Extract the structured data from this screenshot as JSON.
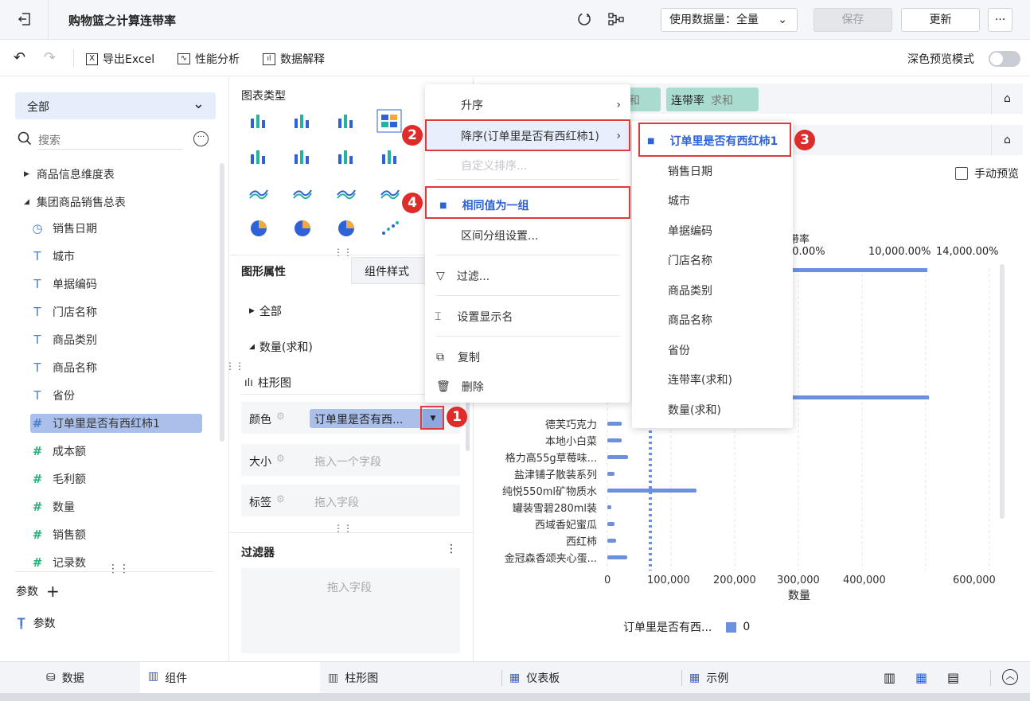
{
  "header": {
    "title": "购物篮之计算连带率",
    "data_amount": "使用数据量：全量",
    "save": "保存",
    "update": "更新",
    "more": "···"
  },
  "toolbar": {
    "export_excel": "导出Excel",
    "perf_analysis": "性能分析",
    "data_explain": "数据解释",
    "dark_preview": "深色预览模式"
  },
  "left": {
    "scope": "全部",
    "search_placeholder": "搜索",
    "tables": [
      "商品信息维度表",
      "集团商品销售总表"
    ],
    "fields": [
      {
        "icon": "clock-icon",
        "glyph": "◷",
        "label": "销售日期"
      },
      {
        "icon": "text-icon",
        "glyph": "T",
        "label": "城市"
      },
      {
        "icon": "text-icon",
        "glyph": "T",
        "label": "单据编码"
      },
      {
        "icon": "text-icon",
        "glyph": "T",
        "label": "门店名称"
      },
      {
        "icon": "text-icon",
        "glyph": "T",
        "label": "商品类别"
      },
      {
        "icon": "text-icon",
        "glyph": "T",
        "label": "商品名称"
      },
      {
        "icon": "text-icon",
        "glyph": "T",
        "label": "省份"
      },
      {
        "icon": "calc-icon",
        "glyph": "#",
        "label": "订单里是否有西红柿1"
      },
      {
        "icon": "number-icon",
        "glyph": "#",
        "label": "成本额"
      },
      {
        "icon": "number-icon",
        "glyph": "#",
        "label": "毛利额"
      },
      {
        "icon": "number-icon",
        "glyph": "#",
        "label": "数量"
      },
      {
        "icon": "number-icon",
        "glyph": "#",
        "label": "销售额"
      },
      {
        "icon": "number-icon",
        "glyph": "#",
        "label": "记录数"
      }
    ],
    "param_label": "参数",
    "param_item": "参数"
  },
  "mid": {
    "chart_type_title": "图表类型",
    "tab_props": "图形属性",
    "tab_style": "组件样式",
    "all": "全部",
    "measure": "数量(求和)",
    "bar_chart": "柱形图",
    "color_label": "颜色",
    "color_value": "订单里是否有西...",
    "size_label": "大小",
    "size_placeholder": "拖入一个字段",
    "label_label": "标签",
    "label_placeholder": "拖入字段",
    "filter_title": "过滤器",
    "filter_placeholder": "拖入字段"
  },
  "right": {
    "chip1": "和",
    "chip2_name": "连带率",
    "chip2_agg": "求和",
    "manual_preview": "手动预览",
    "top_axis_title": "带率",
    "top_ticks": [
      "00.00%",
      "10,000.00%",
      "14,000.00%"
    ],
    "bottom_ticks": [
      "0",
      "100,000",
      "200,000",
      "300,000",
      "400,000",
      "600,000"
    ],
    "x_title": "数量",
    "legend_label": "订单里是否有西...",
    "legend_value": "0"
  },
  "chart_data": {
    "type": "bar",
    "categories": [
      "德芙巧克力",
      "本地小白菜",
      "格力高55g草莓味...",
      "盐津铺子散装系列",
      "纯悦550ml矿物质水",
      "罐装雪碧280ml装",
      "西域香妃蜜瓜",
      "西红柿",
      "金冠森香颂夹心蛋..."
    ],
    "values": [
      22000,
      23000,
      33000,
      11000,
      140000,
      6000,
      11000,
      14000,
      31000
    ],
    "xlabel": "数量",
    "series": [
      {
        "name": "0",
        "values": [
          22000,
          23000,
          33000,
          11000,
          140000,
          6000,
          11000,
          14000,
          31000
        ]
      }
    ]
  },
  "context_menu": {
    "items": [
      "升序",
      "降序(订单里是否有西红柿1)",
      "自定义排序...",
      "相同值为一组",
      "区间分组设置...",
      "过滤...",
      "设置显示名",
      "复制",
      "删除"
    ]
  },
  "submenu": {
    "items": [
      "订单里是否有西红柿1",
      "销售日期",
      "城市",
      "单据编码",
      "门店名称",
      "商品类别",
      "商品名称",
      "省份",
      "连带率(求和)",
      "数量(求和)"
    ]
  },
  "badges": [
    "1",
    "2",
    "3",
    "4"
  ],
  "bottom": {
    "tabs": [
      "数据",
      "组件",
      "柱形图",
      "仪表板",
      "示例"
    ]
  }
}
